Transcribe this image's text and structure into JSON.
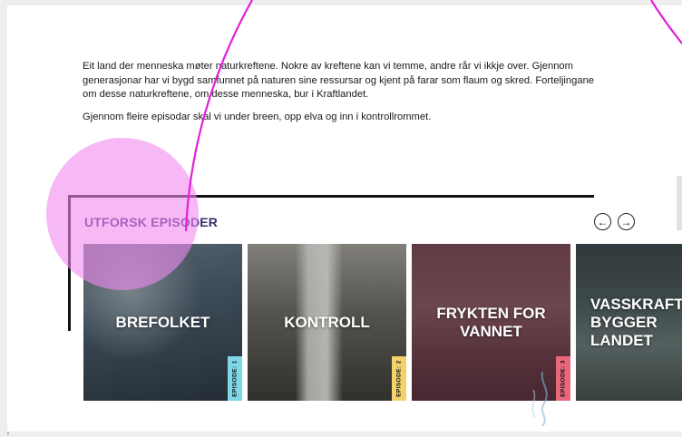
{
  "intro": {
    "paragraph1": "Eit land der menneska møter naturkreftene. Nokre av kreftene kan vi temme, andre rår vi ikkje over. Gjennom generasjonar har vi bygd samfunnet på naturen sine ressursar og kjent på farar som flaum og skred. Forteljingane om desse naturkreftene, om desse menneska, bur i Kraftlandet.",
    "paragraph2": "Gjennom fleire episodar skal vi under breen, opp elva og inn i kontrollrommet."
  },
  "section": {
    "title": "UTFORSK EPISODER",
    "prev_icon": "arrow-left-icon",
    "next_icon": "arrow-right-icon",
    "prev_glyph": "←",
    "next_glyph": "→"
  },
  "episodes": [
    {
      "title": "BREFOLKET",
      "tag": "EPISODE: 1",
      "tag_color": "#7fd8e8"
    },
    {
      "title": "KONTROLL",
      "tag": "EPISODE: 2",
      "tag_color": "#f2d36b"
    },
    {
      "title": "FRYKTEN FOR VANNET",
      "tag": "EPISODE: 3",
      "tag_color": "#e8677a"
    },
    {
      "title": "VASSKRAFT BYGGER LANDET",
      "tag": "",
      "tag_color": ""
    }
  ],
  "colors": {
    "title": "#3b2a6e",
    "highlight": "#f08af0",
    "annotation_line": "#e21fd8"
  }
}
